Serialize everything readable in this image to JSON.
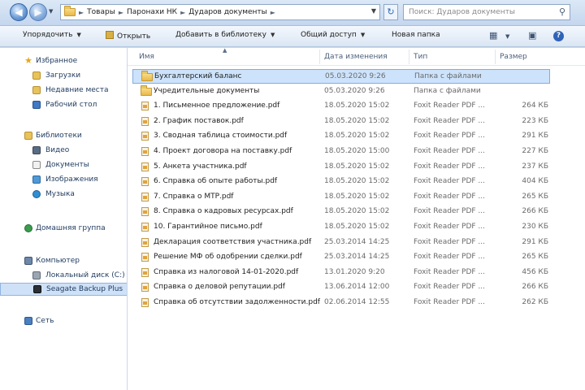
{
  "address": {
    "crumbs": [
      "Товары",
      "Паронахи НК",
      "Дударов документы"
    ],
    "search_placeholder": "Поиск: Дударов документы"
  },
  "toolbar": {
    "organize": "Упорядочить",
    "open": "Открыть",
    "add_to_library": "Добавить в библиотеку",
    "share": "Общий доступ",
    "new_folder": "Новая папка"
  },
  "navpane": {
    "favorites": "Избранное",
    "favorites_items": [
      "Загрузки",
      "Недавние места",
      "Рабочий стол"
    ],
    "libraries": "Библиотеки",
    "libraries_items": [
      "Видео",
      "Документы",
      "Изображения",
      "Музыка"
    ],
    "homegroup": "Домашняя группа",
    "computer": "Компьютер",
    "computer_items": [
      "Локальный диск (C:)",
      "Seagate Backup Plus"
    ],
    "network": "Сеть"
  },
  "columns": {
    "name": "Имя",
    "date": "Дата изменения",
    "type": "Тип",
    "size": "Размер"
  },
  "files": [
    {
      "name": "Бухгалтерский баланс",
      "date": "05.03.2020 9:26",
      "type": "Папка с файлами",
      "size": "",
      "folder": true
    },
    {
      "name": "Учредительные документы",
      "date": "05.03.2020 9:26",
      "type": "Папка с файлами",
      "size": "",
      "folder": true
    },
    {
      "name": "1. Письменное предложение.pdf",
      "date": "18.05.2020 15:02",
      "type": "Foxit Reader PDF ...",
      "size": "264 КБ",
      "folder": false
    },
    {
      "name": "2. График поставок.pdf",
      "date": "18.05.2020 15:02",
      "type": "Foxit Reader PDF ...",
      "size": "223 КБ",
      "folder": false
    },
    {
      "name": "3. Сводная таблица стоимости.pdf",
      "date": "18.05.2020 15:02",
      "type": "Foxit Reader PDF ...",
      "size": "291 КБ",
      "folder": false
    },
    {
      "name": "4. Проект договора на поставку.pdf",
      "date": "18.05.2020 15:00",
      "type": "Foxit Reader PDF ...",
      "size": "227 КБ",
      "folder": false
    },
    {
      "name": "5. Анкета участника.pdf",
      "date": "18.05.2020 15:02",
      "type": "Foxit Reader PDF ...",
      "size": "237 КБ",
      "folder": false
    },
    {
      "name": "6. Справка об опыте работы.pdf",
      "date": "18.05.2020 15:02",
      "type": "Foxit Reader PDF ...",
      "size": "404 КБ",
      "folder": false
    },
    {
      "name": "7. Справка о МТР.pdf",
      "date": "18.05.2020 15:02",
      "type": "Foxit Reader PDF ...",
      "size": "265 КБ",
      "folder": false
    },
    {
      "name": "8. Справка о кадровых ресурсах.pdf",
      "date": "18.05.2020 15:02",
      "type": "Foxit Reader PDF ...",
      "size": "266 КБ",
      "folder": false
    },
    {
      "name": "10. Гарантийное письмо.pdf",
      "date": "18.05.2020 15:02",
      "type": "Foxit Reader PDF ...",
      "size": "230 КБ",
      "folder": false
    },
    {
      "name": "Декларация соответствия участника.pdf",
      "date": "25.03.2014 14:25",
      "type": "Foxit Reader PDF ...",
      "size": "291 КБ",
      "folder": false
    },
    {
      "name": "Решение МФ об одобрении сделки.pdf",
      "date": "25.03.2014 14:25",
      "type": "Foxit Reader PDF ...",
      "size": "265 КБ",
      "folder": false
    },
    {
      "name": "Справка из налоговой 14-01-2020.pdf",
      "date": "13.01.2020 9:20",
      "type": "Foxit Reader PDF ...",
      "size": "456 КБ",
      "folder": false
    },
    {
      "name": "Справка о деловой репутации.pdf",
      "date": "13.06.2014 12:00",
      "type": "Foxit Reader PDF ...",
      "size": "266 КБ",
      "folder": false
    },
    {
      "name": "Справка об отсутствии задолженности.pdf",
      "date": "02.06.2014 12:55",
      "type": "Foxit Reader PDF ...",
      "size": "262 КБ",
      "folder": false
    }
  ],
  "colors": {
    "accent": "#2f63b6",
    "selection": "#cde3fb",
    "folder": "#e9b84a"
  }
}
